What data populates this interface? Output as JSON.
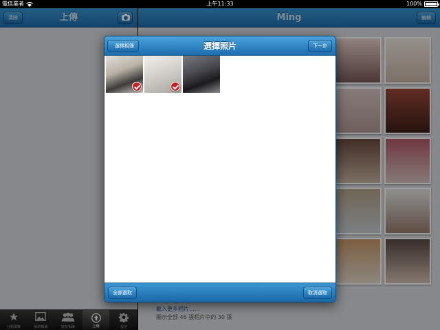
{
  "statusbar": {
    "carrier": "電信業者",
    "time": "上午11:33",
    "battery": "100%",
    "battery_level": 1.0
  },
  "left": {
    "title": "上傳",
    "clear_label": "清除",
    "tabs": [
      {
        "label": "分類相簿",
        "icon": "star-icon"
      },
      {
        "label": "我的相簿",
        "icon": "photo-icon"
      },
      {
        "label": "好友相簿",
        "icon": "people-icon"
      },
      {
        "label": "上傳",
        "icon": "upload-icon",
        "active": true
      },
      {
        "label": "設定",
        "icon": "gear-icon"
      }
    ]
  },
  "right": {
    "title": "Ming",
    "edit_label": "編輯",
    "load_more": "載入更多相片......",
    "show_count": "顯示全部 46 張相片中的 30 張"
  },
  "modal": {
    "title": "選擇照片",
    "back_label": "選擇相簿",
    "next_label": "下一步",
    "select_all_label": "全部選取",
    "deselect_label": "取消選取",
    "photos": [
      {
        "selected": true,
        "color": "#b8b1a6"
      },
      {
        "selected": true,
        "color": "#d4d1cc"
      },
      {
        "selected": false,
        "color": "#4b4b52"
      }
    ]
  },
  "colors": {
    "accent": "#1e6fb0",
    "check": "#c81e24"
  }
}
